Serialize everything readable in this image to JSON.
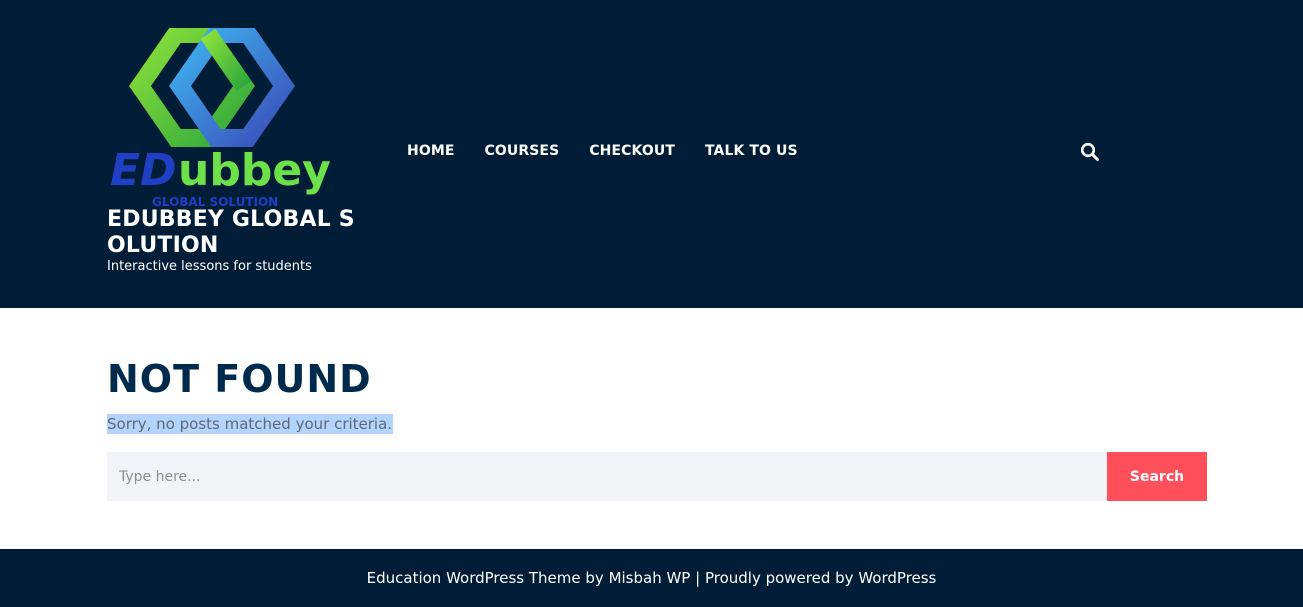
{
  "header": {
    "logo": {
      "wordmark_ed": "ED",
      "wordmark_rest": "ubbey",
      "subtext": "GLOBAL SOLUTION"
    },
    "site_title": "EDUBBEY GLOBAL SOLUTION",
    "tagline": "Interactive lessons for students",
    "nav": [
      {
        "label": "HOME"
      },
      {
        "label": "COURSES"
      },
      {
        "label": "CHECKOUT"
      },
      {
        "label": "TALK TO US"
      }
    ],
    "search_icon": "search-icon"
  },
  "main": {
    "title": "NOT FOUND",
    "message": "Sorry, no posts matched your criteria.",
    "search": {
      "placeholder": "Type here...",
      "value": "",
      "button_label": "Search"
    }
  },
  "footer": {
    "theme_link": "Education WordPress Theme",
    "by_text": " by ",
    "author_link": "Misbah WP",
    "separator": " | ",
    "powered_text": "Proudly powered by ",
    "wp_link": "WordPress"
  },
  "colors": {
    "header_bg": "#001d37",
    "title_color": "#002a4c",
    "button_bg": "#ff4f5a",
    "input_bg": "#f2f3f6",
    "selection": "#b3d4fc"
  }
}
